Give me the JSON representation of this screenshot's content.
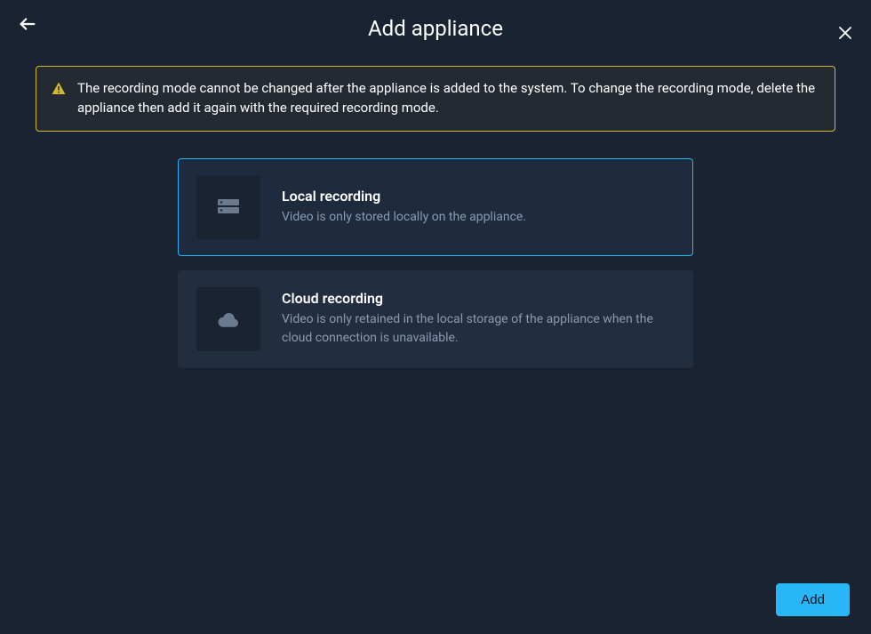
{
  "header": {
    "title": "Add appliance"
  },
  "warning": {
    "text": "The recording mode cannot be changed after the appliance is added to the system. To change the recording mode, delete the appliance then add it again with the required recording mode."
  },
  "options": {
    "local": {
      "title": "Local recording",
      "description": "Video is only stored locally on the appliance."
    },
    "cloud": {
      "title": "Cloud recording",
      "description": "Video is only retained in the local storage of the appliance when the cloud connection is unavailable."
    }
  },
  "footer": {
    "add_label": "Add"
  }
}
